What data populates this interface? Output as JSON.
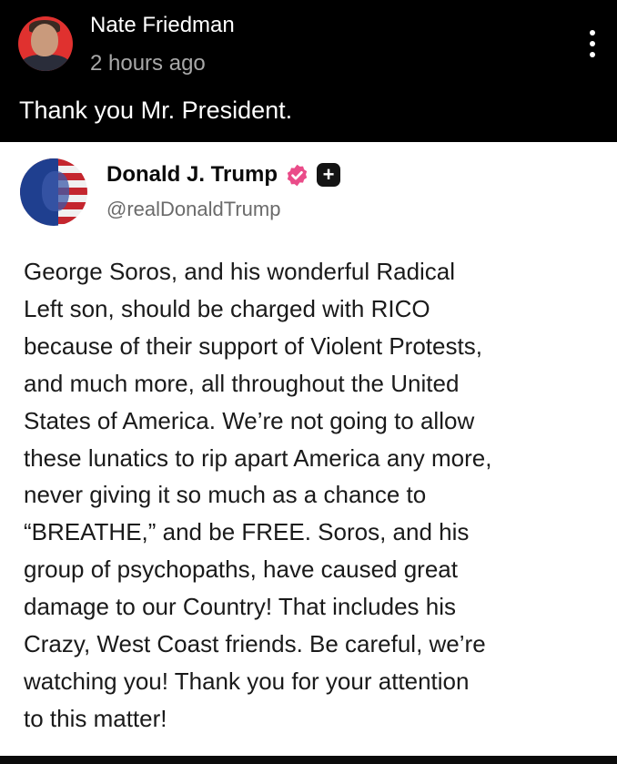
{
  "top_post": {
    "author_name": "Nate Friedman",
    "timestamp": "2 hours ago",
    "text": "Thank you Mr. President."
  },
  "quoted_post": {
    "author_name": "Donald J. Trump",
    "handle": "@realDonaldTrump",
    "body_lines": [
      "George Soros, and his wonderful Radical",
      "Left son, should be charged with RICO",
      "because of their support of Violent Protests,",
      "and much more, all throughout the United",
      "States of America. We’re not going to allow",
      "these lunatics to rip apart America any more,",
      "never giving it so much as a chance to",
      "“BREATHE,” and be FREE. Soros, and his",
      "group of psychopaths, have caused great",
      "damage to our Country! That includes his",
      "Crazy, West Coast friends. Be careful, we’re",
      "watching you! Thank you for your attention",
      "to this matter!"
    ]
  },
  "icons": {
    "more": "more-vertical-icon",
    "verified": "verified-badge-icon",
    "plus": "plus-icon"
  },
  "colors": {
    "background_dark": "#000000",
    "card_background": "#ffffff",
    "verified_pink": "#ea4c89",
    "secondary_text": "#a8a8a8"
  }
}
